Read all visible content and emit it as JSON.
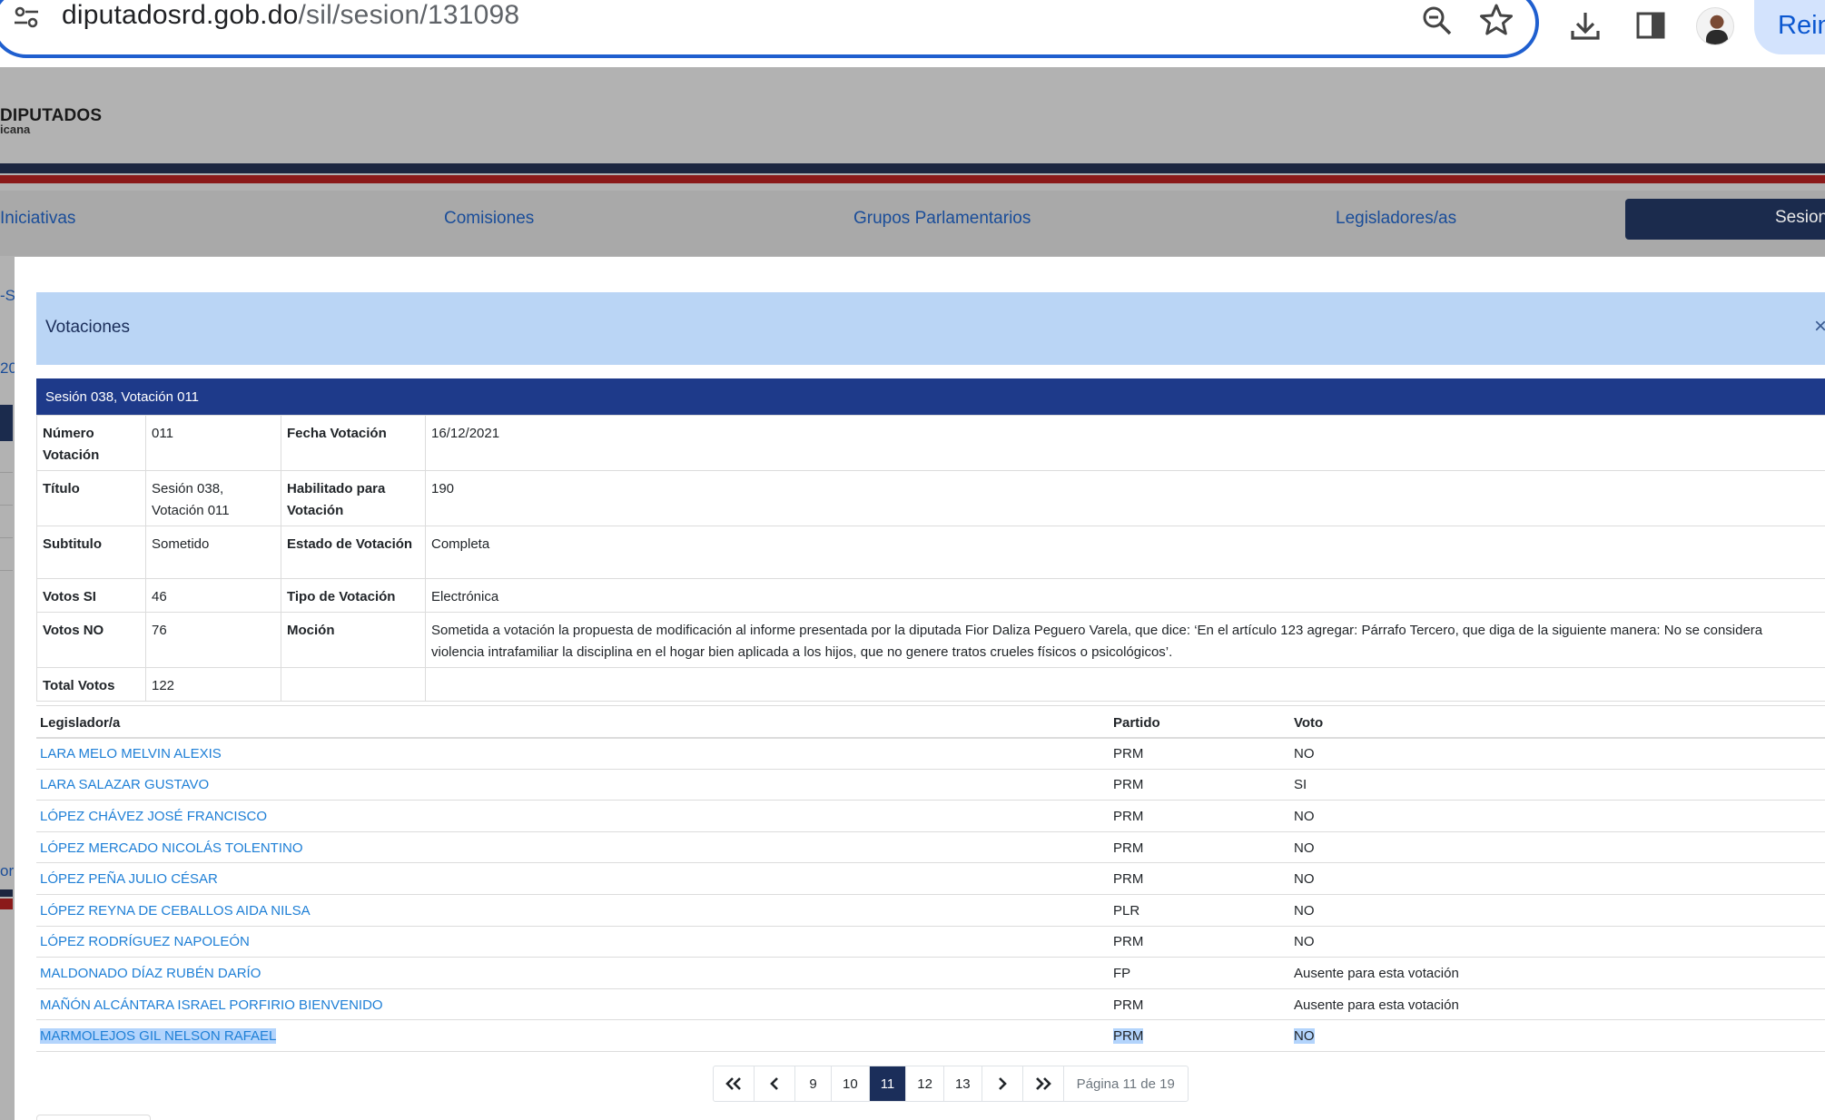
{
  "browser": {
    "url_host": "diputadosrd.gob.do",
    "url_path": "/sil/sesion/131098",
    "profile_label": "Rein"
  },
  "background": {
    "brand_title": "DIPUTADOS",
    "brand_subtitle": "icana",
    "nav": [
      {
        "label": "Iniciativas"
      },
      {
        "label": "Comisiones"
      },
      {
        "label": "Grupos Parlamentarios"
      },
      {
        "label": "Legisladores/as"
      },
      {
        "label": "Sesion"
      }
    ],
    "fragments": {
      "a": "-S",
      "b": "20",
      "c": "or"
    }
  },
  "modal": {
    "title": "Votaciones",
    "close_label": "×",
    "section_title": "Sesión 038, Votación 011",
    "info": {
      "numero_label": "Número Votación",
      "numero_value": "011",
      "fecha_label": "Fecha Votación",
      "fecha_value": "16/12/2021",
      "titulo_label": "Título",
      "titulo_value": "Sesión 038, Votación 011",
      "habilitado_label": "Habilitado para Votación",
      "habilitado_value": "190",
      "subtitulo_label": "Subtitulo",
      "subtitulo_value": "Sometido",
      "estado_label": "Estado de Votación",
      "estado_value": "Completa",
      "si_label": "Votos SI",
      "si_value": "46",
      "tipo_label": "Tipo de Votación",
      "tipo_value": "Electrónica",
      "no_label": "Votos NO",
      "no_value": "76",
      "mocion_label": "Moción",
      "mocion_value": "Sometida a votación la propuesta de modificación al informe presentada por la diputada Fior Daliza Peguero Varela, que dice: ‘En el artículo 123 agregar: Párrafo Tercero, que diga de la siguiente manera: No se considera violencia intrafamiliar la disciplina en el hogar bien aplicada a los hijos, que no genere tratos crueles físicos o psicológicos’.",
      "total_label": "Total Votos",
      "total_value": "122"
    },
    "votes_table": {
      "headers": {
        "legislador": "Legislador/a",
        "partido": "Partido",
        "voto": "Voto"
      },
      "rows": [
        {
          "name": "LARA MELO MELVIN ALEXIS",
          "party": "PRM",
          "vote": "NO"
        },
        {
          "name": "LARA SALAZAR GUSTAVO",
          "party": "PRM",
          "vote": "SI"
        },
        {
          "name": "LÓPEZ CHÁVEZ JOSÉ FRANCISCO",
          "party": "PRM",
          "vote": "NO"
        },
        {
          "name": "LÓPEZ MERCADO NICOLÁS TOLENTINO",
          "party": "PRM",
          "vote": "NO"
        },
        {
          "name": "LÓPEZ PEÑA JULIO CÉSAR",
          "party": "PRM",
          "vote": "NO"
        },
        {
          "name": "LÓPEZ REYNA DE CEBALLOS AIDA NILSA",
          "party": "PLR",
          "vote": "NO"
        },
        {
          "name": "LÓPEZ RODRÍGUEZ NAPOLEÓN",
          "party": "PRM",
          "vote": "NO"
        },
        {
          "name": "MALDONADO DÍAZ RUBÉN DARÍO",
          "party": "FP",
          "vote": "Ausente para esta votación"
        },
        {
          "name": "MAÑÓN ALCÁNTARA ISRAEL PORFIRIO BIENVENIDO",
          "party": "PRM",
          "vote": "Ausente para esta votación"
        },
        {
          "name": "MARMOLEJOS GIL NELSON RAFAEL",
          "party": "PRM",
          "vote": "NO"
        }
      ]
    },
    "pagination": {
      "pages": [
        "9",
        "10",
        "11",
        "12",
        "13"
      ],
      "current": "11",
      "info": "Página 11 de 19"
    }
  }
}
